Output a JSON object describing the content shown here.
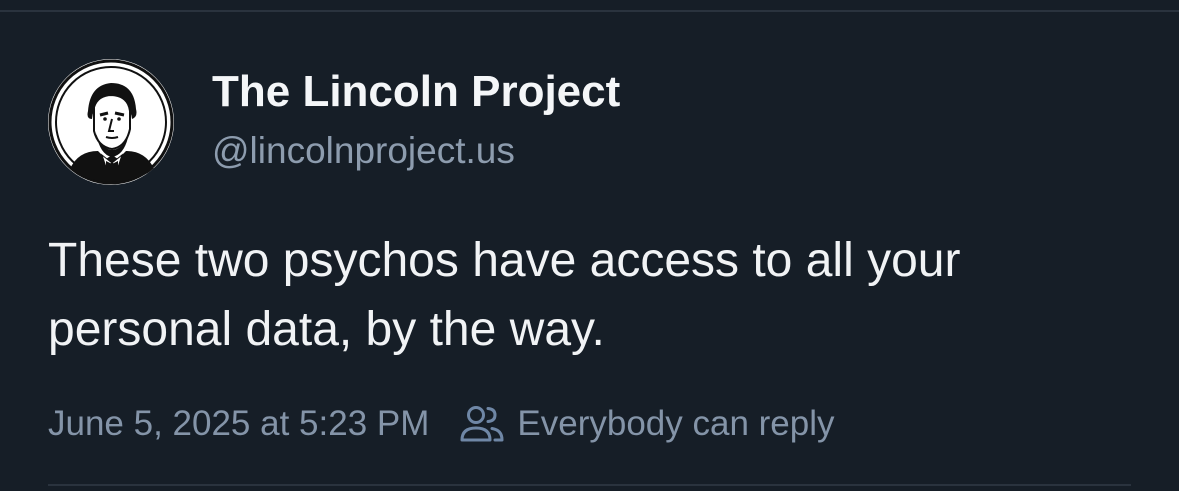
{
  "post": {
    "author": {
      "display_name": "The Lincoln Project",
      "handle": "@lincolnproject.us",
      "avatar_icon": "lincoln-portrait-avatar"
    },
    "text": "These two psychos have access to all your\npersonal data, by the way.",
    "timestamp": "June 5, 2025 at 5:23 PM",
    "reply_setting": {
      "icon": "people-icon",
      "label": "Everybody can reply"
    }
  },
  "colors": {
    "background": "#161e27",
    "text_primary": "#f1f3f5",
    "text_secondary": "#8d9cae",
    "divider": "#2a333e",
    "icon_accent": "#6f87a6"
  }
}
